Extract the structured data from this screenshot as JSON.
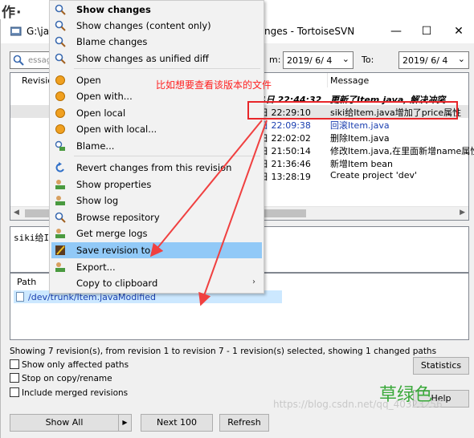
{
  "page": {
    "heading": "作·"
  },
  "window": {
    "title_left": "G:\\jav",
    "title_right": "nges - TortoiseSVN",
    "minimize": "—",
    "maximize": "☐",
    "close": "✕"
  },
  "filter": {
    "search_placeholder": "essag",
    "from_label": "m:",
    "from_date": "2019/ 6/ 4",
    "to_label": "To:",
    "to_date": "2019/ 6/ 4"
  },
  "rev_list": {
    "columns": {
      "revision": "Revisio",
      "message": "Message"
    },
    "rows": [
      {
        "date": "4日 22:44:32",
        "message": "更新了Item.java, 解决冲突"
      },
      {
        "date": "日 22:29:10",
        "message": "siki给Item.java增加了price属性"
      },
      {
        "date": "日 22:09:38",
        "message": "回滚Item.java"
      },
      {
        "date": "日 22:02:02",
        "message": "删除Item.java"
      },
      {
        "date": "日 21:50:14",
        "message": "修改Item.java,在里面新增name属性"
      },
      {
        "date": "日 21:36:46",
        "message": "新增Item bean"
      },
      {
        "date": "日 13:28:19",
        "message": "Create project 'dev'"
      }
    ]
  },
  "message_box": {
    "text": "siki给I"
  },
  "path_list": {
    "header": "Path",
    "row": {
      "path": "/dev/trunk/Item.java",
      "action": "Modified"
    }
  },
  "status": {
    "text": "Showing 7 revision(s), from revision 1 to revision 7 - 1 revision(s) selected, showing 1 changed paths"
  },
  "options": {
    "only_affected": "Show only affected paths",
    "stop_copy": "Stop on copy/rename",
    "include_merged": "Include merged revisions"
  },
  "buttons": {
    "statistics": "Statistics",
    "help": "Help",
    "show_all": "Show All",
    "next100": "Next 100",
    "refresh": "Refresh"
  },
  "context_menu": {
    "items": [
      {
        "label": "Show changes",
        "icon": "magnifier-icon"
      },
      {
        "label": "Show changes (content only)",
        "icon": "magnifier-icon"
      },
      {
        "label": "Blame changes",
        "icon": "magnifier-icon"
      },
      {
        "label": "Show changes as unified diff",
        "icon": "magnifier-icon"
      },
      {
        "label": "Open",
        "icon": "open-icon"
      },
      {
        "label": "Open with...",
        "icon": "open-icon"
      },
      {
        "label": "Open local",
        "icon": "open-icon"
      },
      {
        "label": "Open with local...",
        "icon": "open-icon"
      },
      {
        "label": "Blame...",
        "icon": "blame-icon"
      },
      {
        "label": "Revert changes from this revision",
        "icon": "revert-icon"
      },
      {
        "label": "Show properties",
        "icon": "svn-icon"
      },
      {
        "label": "Show log",
        "icon": "svn-icon"
      },
      {
        "label": "Browse repository",
        "icon": "magnifier-icon"
      },
      {
        "label": "Get merge logs",
        "icon": "svn-icon"
      },
      {
        "label": "Save revision to...",
        "icon": "save-icon"
      },
      {
        "label": "Export...",
        "icon": "svn-icon"
      },
      {
        "label": "Copy to clipboard",
        "icon": "none"
      }
    ]
  },
  "annotation": {
    "text": "比如想要查看该版本的文件"
  },
  "watermark": {
    "url": "https://blog.csdn.net/qq_40323256",
    "name": "草绿色"
  },
  "colors": {
    "menu_highlight": "#91c9f7",
    "row_selected": "#cce8ff",
    "annotation_red": "#e8262a",
    "link_blue": "#1a3fb0",
    "watermark_green": "#3aa93a"
  }
}
